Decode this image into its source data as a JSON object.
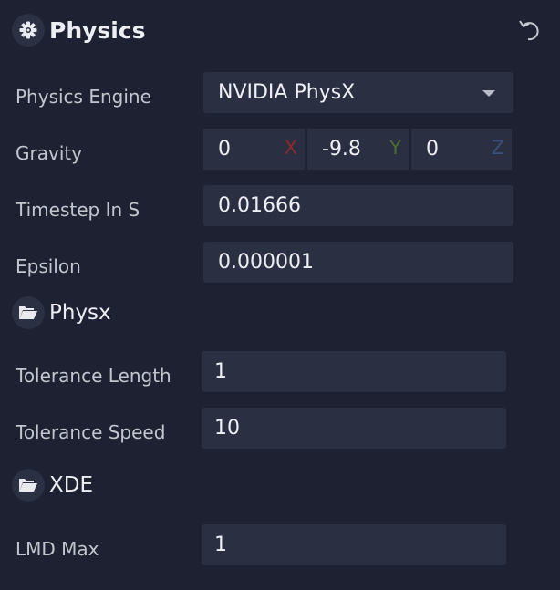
{
  "physics": {
    "title": "Physics",
    "icon": "settings-gear-icon",
    "engine": {
      "label": "Physics Engine",
      "value": "NVIDIA PhysX"
    },
    "gravity": {
      "label": "Gravity",
      "x": "0",
      "y": "-9.8",
      "z": "0",
      "x_axis": "X",
      "y_axis": "Y",
      "z_axis": "Z"
    },
    "timestep": {
      "label": "Timestep In S",
      "value": "0.01666"
    },
    "epsilon": {
      "label": "Epsilon",
      "value": "0.000001"
    }
  },
  "physx": {
    "title": "Physx",
    "icon": "folder-open-icon",
    "tolerance_length": {
      "label": "Tolerance Length",
      "value": "1"
    },
    "tolerance_speed": {
      "label": "Tolerance Speed",
      "value": "10"
    }
  },
  "xde": {
    "title": "XDE",
    "icon": "folder-open-icon",
    "lmd_max": {
      "label": "LMD Max",
      "value": "1"
    }
  },
  "colors": {
    "background": "#1e2131",
    "field": "#2b2f42",
    "axis_x": "#8b2a2a",
    "axis_y": "#4c6b39",
    "axis_z": "#3c4f78"
  }
}
